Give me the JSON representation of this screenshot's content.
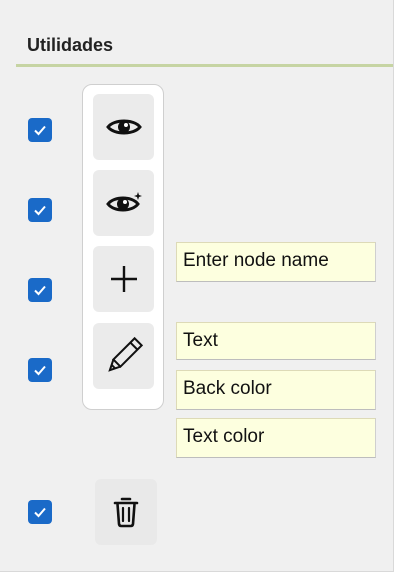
{
  "header": {
    "title": "Utilidades"
  },
  "colors": {
    "accent": "#1a6ac8",
    "field_bg": "#fdffdf",
    "divider": "#c6d4a3"
  },
  "checkboxes": [
    {
      "checked": true
    },
    {
      "checked": true
    },
    {
      "checked": true
    },
    {
      "checked": true
    },
    {
      "checked": true
    }
  ],
  "tools": [
    {
      "icon": "eye-icon"
    },
    {
      "icon": "eye-sparkle-icon"
    },
    {
      "icon": "plus-icon"
    },
    {
      "icon": "pencil-icon"
    },
    {
      "icon": "trash-icon"
    }
  ],
  "fields": {
    "node_name": "Enter node name",
    "text": "Text",
    "back_color": "Back color",
    "text_color": "Text color"
  }
}
